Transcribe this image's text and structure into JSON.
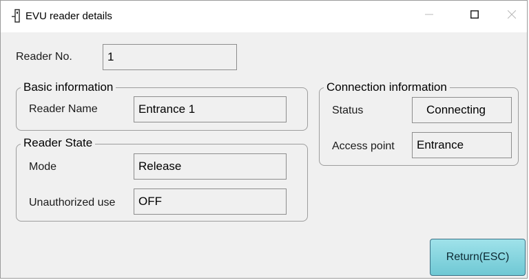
{
  "window": {
    "title": "EVU reader details",
    "icon": "reader-device-icon"
  },
  "window_controls": {
    "minimize_icon": "minimize-icon",
    "maximize_icon": "maximize-icon",
    "close_icon": "close-icon"
  },
  "reader_no": {
    "label": "Reader No.",
    "value": "1"
  },
  "basic_information": {
    "title": "Basic information",
    "reader_name_label": "Reader Name",
    "reader_name_value": "Entrance 1"
  },
  "reader_state": {
    "title": "Reader State",
    "mode_label": "Mode",
    "mode_value": "Release",
    "unauthorized_label": "Unauthorized use",
    "unauthorized_value": "OFF"
  },
  "connection_information": {
    "title": "Connection information",
    "status_label": "Status",
    "status_value": "Connecting",
    "access_point_label": "Access point",
    "access_point_value": "Entrance"
  },
  "return_button": {
    "label": "Return(ESC)",
    "color": "#7fd3dd"
  }
}
